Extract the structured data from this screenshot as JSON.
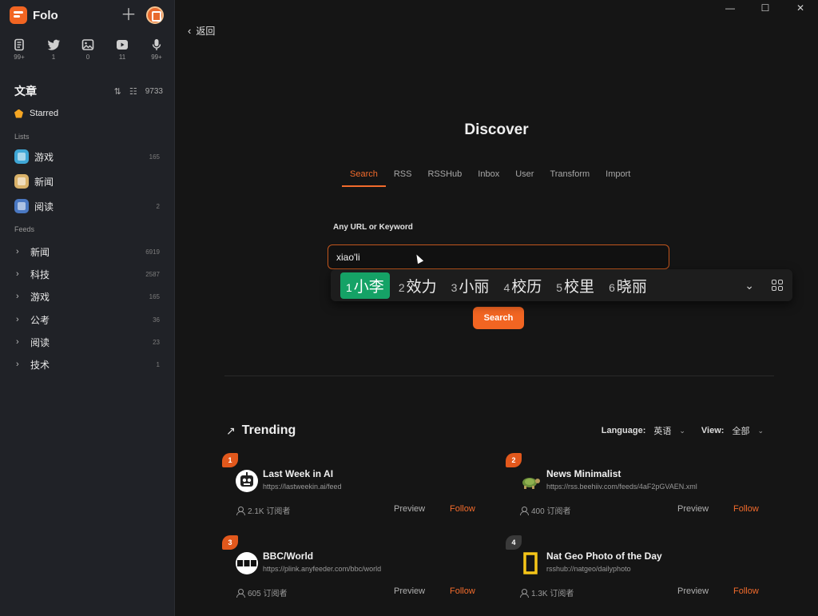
{
  "app": {
    "name": "Folo"
  },
  "views": [
    {
      "icon": "article-icon",
      "count": "99+"
    },
    {
      "icon": "twitter-icon",
      "count": "1"
    },
    {
      "icon": "picture-icon",
      "count": "0"
    },
    {
      "icon": "video-icon",
      "count": "11"
    },
    {
      "icon": "microphone-icon",
      "count": "99+"
    }
  ],
  "sidebar": {
    "section_title": "文章",
    "total_count": "9733",
    "starred": "Starred",
    "lists_label": "Lists",
    "lists": [
      {
        "name": "游戏",
        "count": "165",
        "color": "#3fa7d6"
      },
      {
        "name": "新闻",
        "count": "",
        "color": "#d9b26a"
      },
      {
        "name": "阅读",
        "count": "2",
        "color": "#4a78c2"
      }
    ],
    "feeds_label": "Feeds",
    "feeds": [
      {
        "name": "新闻",
        "count": "6919"
      },
      {
        "name": "科技",
        "count": "2587"
      },
      {
        "name": "游戏",
        "count": "165"
      },
      {
        "name": "公考",
        "count": "36"
      },
      {
        "name": "阅读",
        "count": "23"
      },
      {
        "name": "技术",
        "count": "1"
      }
    ]
  },
  "main": {
    "back_label": "返回",
    "title": "Discover",
    "tabs": [
      "Search",
      "RSS",
      "RSSHub",
      "Inbox",
      "User",
      "Transform",
      "Import"
    ],
    "active_tab": 0,
    "field_label": "Any URL or Keyword",
    "search_value": "xiao'li",
    "search_button": "Search",
    "trending_title": "Trending",
    "language_label": "Language:",
    "language_value": "英语",
    "view_label": "View:",
    "view_value": "全部",
    "preview_label": "Preview",
    "follow_label": "Follow",
    "cards": [
      {
        "rank": "1",
        "name": "Last Week in AI",
        "url": "https://lastweekin.ai/feed",
        "subscribers": "2.1K 订阅者"
      },
      {
        "rank": "2",
        "name": "News Minimalist",
        "url": "https://rss.beehiiv.com/feeds/4aF2pGVAEN.xml",
        "subscribers": "400 订阅者"
      },
      {
        "rank": "3",
        "name": "BBC/World",
        "url": "https://plink.anyfeeder.com/bbc/world",
        "subscribers": "605 订阅者"
      },
      {
        "rank": "4",
        "name": "Nat Geo Photo of the Day",
        "url": "rsshub://natgeo/dailyphoto",
        "subscribers": "1.3K 订阅者"
      }
    ]
  },
  "ime": {
    "candidates": [
      {
        "num": "1",
        "text": "小李"
      },
      {
        "num": "2",
        "text": "效力"
      },
      {
        "num": "3",
        "text": "小丽"
      },
      {
        "num": "4",
        "text": "校历"
      },
      {
        "num": "5",
        "text": "校里"
      },
      {
        "num": "6",
        "text": "晓丽"
      }
    ],
    "selected_color": "#15a266"
  },
  "colors": {
    "accent": "#f26522",
    "sidebar_bg": "#202227",
    "main_bg": "#151515"
  }
}
